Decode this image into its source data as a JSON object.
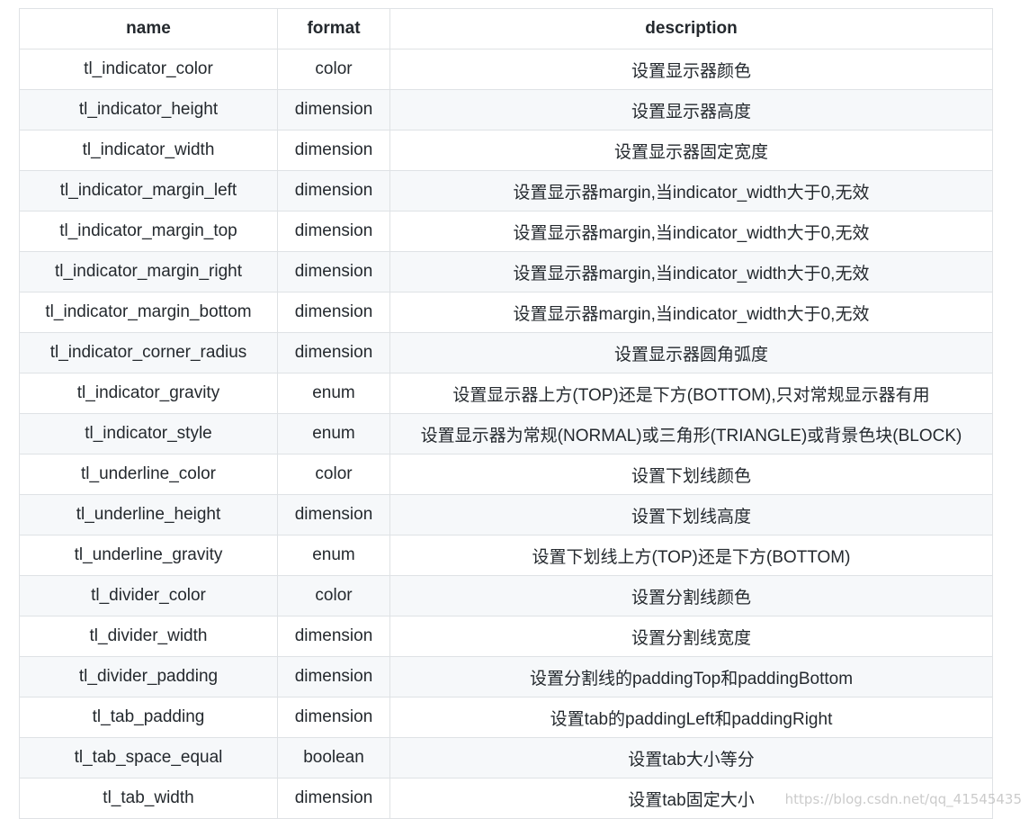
{
  "table": {
    "headers": [
      "name",
      "format",
      "description"
    ],
    "rows": [
      [
        "tl_indicator_color",
        "color",
        "设置显示器颜色"
      ],
      [
        "tl_indicator_height",
        "dimension",
        "设置显示器高度"
      ],
      [
        "tl_indicator_width",
        "dimension",
        "设置显示器固定宽度"
      ],
      [
        "tl_indicator_margin_left",
        "dimension",
        "设置显示器margin,当indicator_width大于0,无效"
      ],
      [
        "tl_indicator_margin_top",
        "dimension",
        "设置显示器margin,当indicator_width大于0,无效"
      ],
      [
        "tl_indicator_margin_right",
        "dimension",
        "设置显示器margin,当indicator_width大于0,无效"
      ],
      [
        "tl_indicator_margin_bottom",
        "dimension",
        "设置显示器margin,当indicator_width大于0,无效"
      ],
      [
        "tl_indicator_corner_radius",
        "dimension",
        "设置显示器圆角弧度"
      ],
      [
        "tl_indicator_gravity",
        "enum",
        "设置显示器上方(TOP)还是下方(BOTTOM),只对常规显示器有用"
      ],
      [
        "tl_indicator_style",
        "enum",
        "设置显示器为常规(NORMAL)或三角形(TRIANGLE)或背景色块(BLOCK)"
      ],
      [
        "tl_underline_color",
        "color",
        "设置下划线颜色"
      ],
      [
        "tl_underline_height",
        "dimension",
        "设置下划线高度"
      ],
      [
        "tl_underline_gravity",
        "enum",
        "设置下划线上方(TOP)还是下方(BOTTOM)"
      ],
      [
        "tl_divider_color",
        "color",
        "设置分割线颜色"
      ],
      [
        "tl_divider_width",
        "dimension",
        "设置分割线宽度"
      ],
      [
        "tl_divider_padding",
        "dimension",
        "设置分割线的paddingTop和paddingBottom"
      ],
      [
        "tl_tab_padding",
        "dimension",
        "设置tab的paddingLeft和paddingRight"
      ],
      [
        "tl_tab_space_equal",
        "boolean",
        "设置tab大小等分"
      ],
      [
        "tl_tab_width",
        "dimension",
        "设置tab固定大小"
      ]
    ]
  },
  "watermark": "https://blog.csdn.net/qq_41545435",
  "colors": {
    "border": "#dfe2e5",
    "stripe": "#f6f8fa",
    "text": "#24292e"
  }
}
